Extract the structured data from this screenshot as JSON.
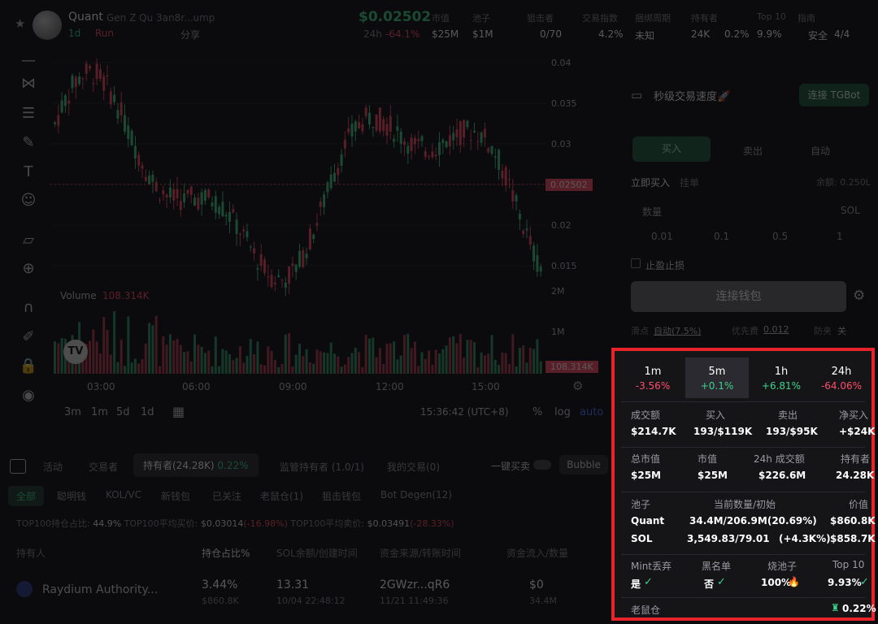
{
  "header": {
    "token_name": "Quant",
    "token_sub": "Gen Z Qu   3an8r...ump",
    "timeframe": "1d",
    "run_label": "Run",
    "share_label": "分享",
    "price": "$0.02502",
    "change_24h_label": "24h",
    "change_24h": "-64.1%",
    "stats": [
      {
        "label": "市值",
        "value": "$25M"
      },
      {
        "label": "池子",
        "value": "$1M"
      },
      {
        "label": "狙击者",
        "value": "0/70"
      },
      {
        "label": "交易指数",
        "value": "4.2%"
      },
      {
        "label": "捆绑周期",
        "value": "未知"
      },
      {
        "label": "持有者",
        "value": "24K",
        "extra": "0.2%"
      },
      {
        "label": "Top 10",
        "value": "9.9%"
      },
      {
        "label": "指南",
        "value": "安全",
        "extra": "4/4"
      }
    ]
  },
  "chart": {
    "y_ticks": [
      "0.04",
      "0.035",
      "0.03",
      "0.025",
      "0.02",
      "0.015"
    ],
    "price_tag": "0.02502",
    "volume_label": "Volume",
    "volume_value": "108.314K",
    "volume_ticks": [
      "2M",
      "1M"
    ],
    "volume_tag": "108.314K",
    "x_ticks": [
      "03:00",
      "06:00",
      "09:00",
      "12:00",
      "15:00"
    ],
    "timeframes": [
      "3m",
      "1m",
      "5d",
      "1d"
    ],
    "clock": "15:36:42 (UTC+8)",
    "scale_opts": [
      "%",
      "log",
      "auto"
    ]
  },
  "trade": {
    "title": "秒级交易速度🚀",
    "connect_tg": "连接 TGBot",
    "buy": "买入",
    "sell": "卖出",
    "auto": "自动",
    "instant_buy": "立即买入",
    "limit": "挂单",
    "balance": "余额: 0.250L",
    "amount": "数量",
    "unit": "SOL",
    "presets": [
      "0.01",
      "0.1",
      "0.5",
      "1"
    ],
    "tpsl": "止盈止损",
    "connect_wallet": "连接钱包",
    "slippage_label": "滑点",
    "slippage": "自动(7.5%)",
    "priority_label": "优先费",
    "priority": "0.012",
    "antimev_label": "防夹",
    "antimev": "关"
  },
  "bottom": {
    "tabs": [
      "活动",
      "交易者",
      "持有者(24.28K)",
      "0.22%",
      "监管持有者 (1.0/1)",
      "我的交易(0)"
    ],
    "quick_buy": "一键买卖",
    "bubble": "Bubble",
    "filters": [
      "全部",
      "聪明钱",
      "KOL/VC",
      "新钱包",
      "已关注",
      "老鼠仓(1)",
      "狙击钱包",
      "Bot Degen(12)"
    ],
    "top100_label": "TOP100持仓占比:",
    "top100_value": "44.9%",
    "avg_buy_label": "TOP100平均买价:",
    "avg_buy": "$0.03014",
    "avg_buy_chg": "(-16.98%)",
    "avg_sell_label": "TOP100平均卖价:",
    "avg_sell": "$0.03491",
    "avg_sell_chg": "(-28.33%)",
    "cols": [
      "持有人",
      "持仓占比%",
      "SOL余额/创建时间",
      "资金来源/转账时间",
      "资金流入/数量"
    ],
    "row": {
      "name": "Raydium Authority...",
      "pct": "3.44%",
      "pct_val": "$860.8K",
      "sol": "13.31",
      "sol_time": "10/04 22:48:12",
      "src": "2GWzr...qR6",
      "src_time": "11/21 11:49:36",
      "flow": "$0",
      "qty": "34.4M"
    }
  },
  "stats": {
    "timeframes": [
      {
        "t": "1m",
        "v": "-3.56%",
        "up": false
      },
      {
        "t": "5m",
        "v": "+0.1%",
        "up": true
      },
      {
        "t": "1h",
        "v": "+6.81%",
        "up": true
      },
      {
        "t": "24h",
        "v": "-64.06%",
        "up": false
      }
    ],
    "vol": {
      "l1": "成交额",
      "v1": "$214.7K",
      "l2": "买入",
      "v2": "193/$119K",
      "l3": "卖出",
      "v3": "193/$95K",
      "l4": "净买入",
      "v4": "+$24K"
    },
    "mcap": {
      "l1": "总市值",
      "v1": "$25M",
      "l2": "市值",
      "v2": "$25M",
      "l3": "24h 成交额",
      "v3": "$226.6M",
      "l4": "持有者",
      "v4": "24.28K"
    },
    "pool": {
      "l1": "池子",
      "l2": "当前数量/初始",
      "l3": "价值",
      "r1n": "Quant",
      "r1q": "34.4M/206.9M(20.69%)",
      "r1v": "$860.8K",
      "r2n": "SOL",
      "r2q": "3,549.83/79.01",
      "r2c": "(+4.3K%)",
      "r2v": "$858.7K"
    },
    "safety": {
      "l1": "Mint丢弃",
      "v1": "是",
      "l2": "黑名单",
      "v2": "否",
      "l3": "烧池子",
      "v3": "100%",
      "l4": "Top 10",
      "v4": "9.93%"
    },
    "rat": {
      "l": "老鼠仓",
      "v": "0.22%"
    }
  },
  "colors": {
    "accent": "#3fd18b",
    "down": "#ff4d6a",
    "highlight": "#e8232c"
  }
}
